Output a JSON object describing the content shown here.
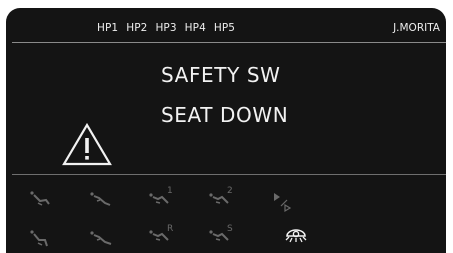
{
  "header": {
    "tabs": [
      "HP1",
      "HP2",
      "HP3",
      "HP4",
      "HP5"
    ],
    "brand": "J.MORITA"
  },
  "message": {
    "line1": "SAFETY SW",
    "line2": "SEAT DOWN",
    "icon": "warning-triangle-icon"
  },
  "controls": {
    "row1": [
      {
        "icon": "chair-position-1-icon",
        "label": ""
      },
      {
        "icon": "chair-position-2-icon",
        "label": ""
      },
      {
        "icon": "chair-memory-1-icon",
        "label": "1"
      },
      {
        "icon": "chair-memory-2-icon",
        "label": "2"
      },
      {
        "icon": "play-step-icon",
        "label": ""
      }
    ],
    "row2": [
      {
        "icon": "chair-position-3-icon",
        "label": ""
      },
      {
        "icon": "chair-position-4-icon",
        "label": ""
      },
      {
        "icon": "chair-return-icon",
        "label": "R"
      },
      {
        "icon": "chair-spittoon-icon",
        "label": "S"
      },
      {
        "icon": "operating-light-icon",
        "label": ""
      }
    ]
  },
  "colors": {
    "background": "#141414",
    "text": "#ededed",
    "dim_icon": "#6a6a6a",
    "active_icon": "#f2f2f2"
  }
}
